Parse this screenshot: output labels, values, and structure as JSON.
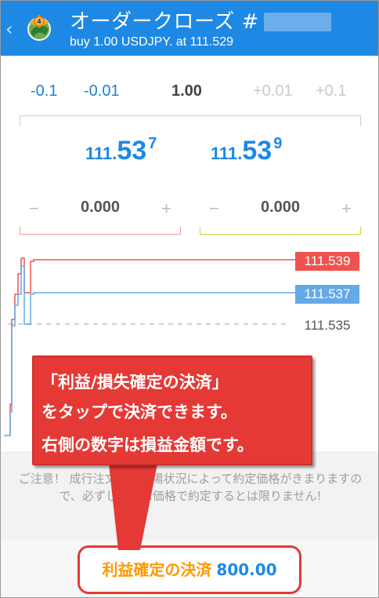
{
  "header": {
    "back_glyph": "‹",
    "title": "オーダークローズ #",
    "subtitle": "buy 1.00 USDJPY. at 111.529",
    "bg_color": "#1e88e5"
  },
  "volume": {
    "minus_0_1": "-0.1",
    "minus_0_01": "-0.01",
    "value": "1.00",
    "plus_0_01": "+0.01",
    "plus_0_1": "+0.1"
  },
  "prices": {
    "bid": {
      "base": "111.",
      "big": "53",
      "sup": "7"
    },
    "ask": {
      "base": "111.",
      "big": "53",
      "sup": "9"
    }
  },
  "stop_loss": {
    "minus": "−",
    "value": "0.000",
    "plus": "+",
    "color": "#ef9a9a"
  },
  "take_profit": {
    "minus": "−",
    "value": "0.000",
    "plus": "+",
    "color": "#cddc39"
  },
  "chart": {
    "ask_tag": "111.539",
    "bid_tag": "111.537",
    "level_tag": "111.535",
    "ask_color": "#ef5350",
    "bid_color": "#64a9e8"
  },
  "callout": {
    "line1": "「利益/損失確定の決済」",
    "line2": "をタップで決済できます。",
    "line3": "右側の数字は損益金額です。",
    "color": "#e53935"
  },
  "notice": {
    "text": "ご注意！ 成行注文は、市場状況によって約定価格がきまりますので、必ずしも提示価格で約定するとは限りません!"
  },
  "close_button": {
    "label": "利益確定の決済",
    "amount": "800.00"
  }
}
